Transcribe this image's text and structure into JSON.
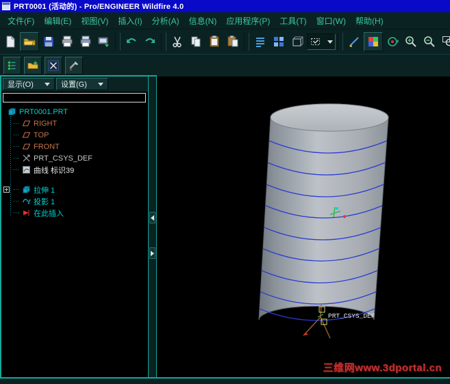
{
  "window": {
    "title": "PRT0001 (活动的) - Pro/ENGINEER Wildfire 4.0"
  },
  "menu": {
    "items": [
      "文件(F)",
      "编辑(E)",
      "视图(V)",
      "插入(I)",
      "分析(A)",
      "信息(N)",
      "应用程序(P)",
      "工具(T)",
      "窗口(W)",
      "帮助(H)"
    ]
  },
  "toolbar_main": {
    "buttons": [
      "new-file",
      "open-file",
      "save",
      "print",
      "plot",
      "export-screen",
      "undo",
      "redo",
      "cut",
      "copy",
      "paste",
      "paste-special",
      "feature-list",
      "regenerate",
      "model-display",
      "selection-filter",
      "sketcher-display",
      "appearance-gallery",
      "spin-center",
      "zoom-in",
      "zoom-out",
      "refit",
      "view-manager"
    ]
  },
  "toolbar_nav": {
    "buttons": [
      "model-tree-toggle",
      "folder-browser-toggle",
      "favorites-toggle",
      "connections-toggle"
    ]
  },
  "tree_panel": {
    "show_button": "显示(O)",
    "settings_button": "设置(G)",
    "items": [
      {
        "label": "PRT0001.PRT",
        "icon": "part-icon"
      },
      {
        "label": "RIGHT",
        "icon": "datum-plane-icon"
      },
      {
        "label": "TOP",
        "icon": "datum-plane-icon"
      },
      {
        "label": "FRONT",
        "icon": "datum-plane-icon"
      },
      {
        "label": "PRT_CSYS_DEF",
        "icon": "csys-icon"
      },
      {
        "label": "曲线 标识39",
        "icon": "curve-icon"
      },
      {
        "label": "拉伸 1",
        "icon": "extrude-icon",
        "expandable": true
      },
      {
        "label": "投影 1",
        "icon": "projection-icon"
      },
      {
        "label": "在此插入",
        "icon": "insert-here-icon"
      }
    ]
  },
  "graphics": {
    "csys_label": "PRT_CSYS_DEF",
    "watermark": "三维网www.3dportal.cn"
  },
  "colors": {
    "titlebar": "#0909c8",
    "panel_border": "#10a89a",
    "menu_text": "#3cc89c",
    "curve_blue": "#2a3cd0",
    "watermark_red": "#c53030",
    "cylinder_gray": "#b0b6bd"
  }
}
